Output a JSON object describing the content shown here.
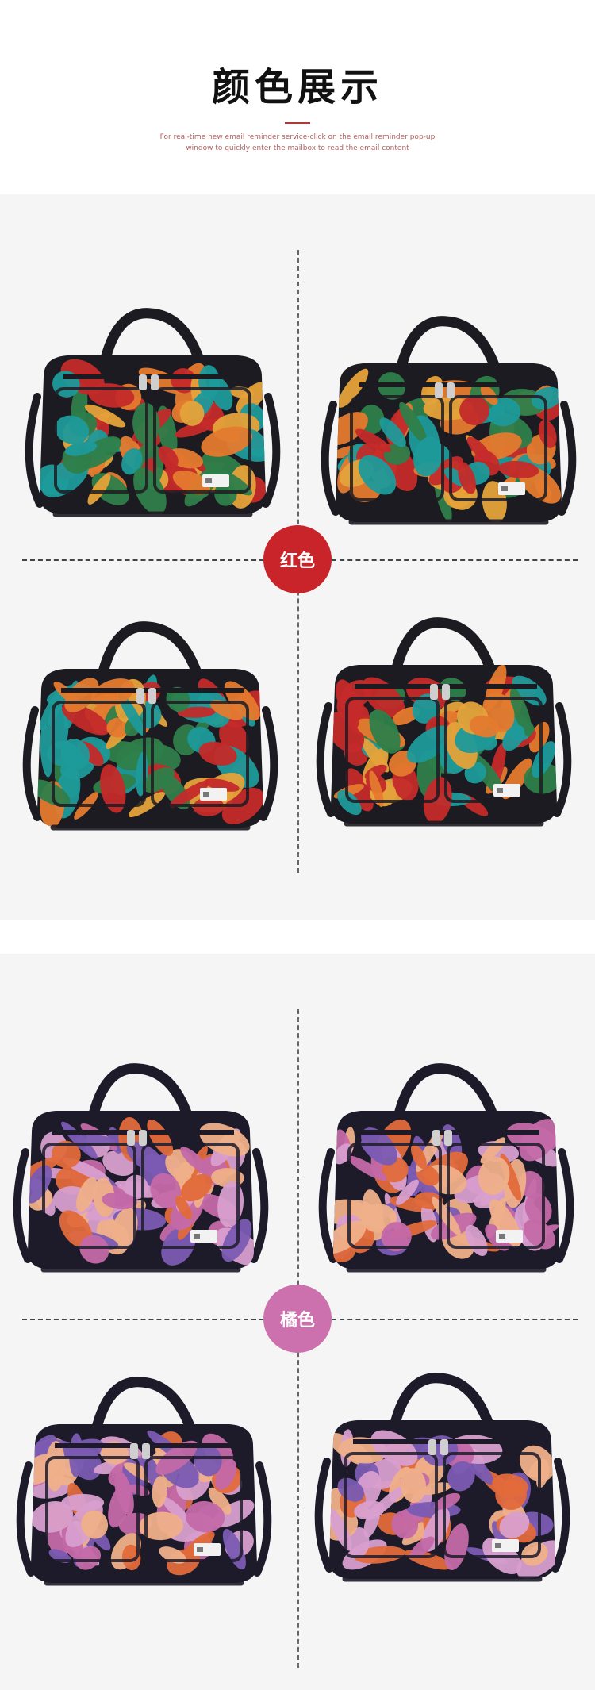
{
  "header": {
    "title": "颜色展示",
    "subtitle": "For real-time new email reminder service-click on the email reminder pop-up window to quickly enter the mailbox to read the email content"
  },
  "sections": [
    {
      "label": "红色",
      "badge_color": "#c8242a",
      "bag_colors": [
        "#1d1b22",
        "#c42b2a",
        "#1e9a9a",
        "#e57b2f",
        "#e5a33a",
        "#2f7f4a"
      ]
    },
    {
      "label": "橘色",
      "badge_color": "#cc71ad",
      "bag_colors": [
        "#1d1b2a",
        "#e26b3b",
        "#c46aa8",
        "#7b5bb3",
        "#f0b08a",
        "#d9a0cf"
      ]
    }
  ],
  "icons": {
    "bag": "duffel-bag-icon"
  }
}
